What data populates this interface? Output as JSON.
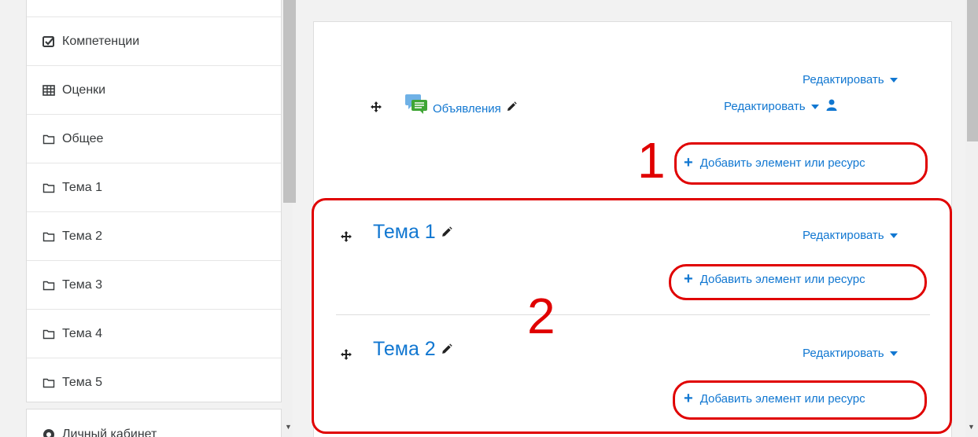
{
  "sidebar": {
    "items": [
      {
        "label": "Компетенции",
        "icon": "checkbox-icon"
      },
      {
        "label": "Оценки",
        "icon": "table-icon"
      },
      {
        "label": "Общее",
        "icon": "folder-icon"
      },
      {
        "label": "Тема 1",
        "icon": "folder-icon"
      },
      {
        "label": "Тема 2",
        "icon": "folder-icon"
      },
      {
        "label": "Тема 3",
        "icon": "folder-icon"
      },
      {
        "label": "Тема 4",
        "icon": "folder-icon"
      },
      {
        "label": "Тема 5",
        "icon": "folder-icon"
      }
    ],
    "secondary": {
      "label": "Личный кабинет",
      "icon": "dashboard-icon"
    }
  },
  "general_section": {
    "announcements_label": "Объявления",
    "edit_label": "Редактировать",
    "add_label": "Добавить элемент или ресурс"
  },
  "topics": [
    {
      "title": "Тема 1",
      "edit_label": "Редактировать",
      "add_label": "Добавить элемент или ресурс"
    },
    {
      "title": "Тема 2",
      "edit_label": "Редактировать",
      "add_label": "Добавить элемент или ресурс"
    }
  ],
  "annotations": {
    "one": "1",
    "two": "2"
  },
  "colors": {
    "link": "#1177d1",
    "annotation": "#e00000"
  }
}
